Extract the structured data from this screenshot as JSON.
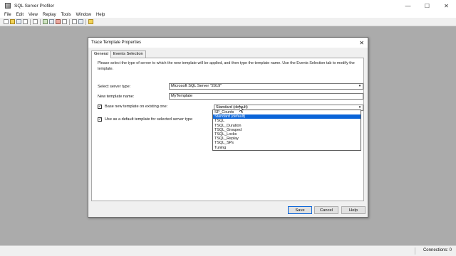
{
  "window": {
    "title": "SQL Server Profiler",
    "controls": {
      "minimize": "—",
      "maximize": "☐",
      "close": "✕"
    }
  },
  "menu": [
    "File",
    "Edit",
    "View",
    "Replay",
    "Tools",
    "Window",
    "Help"
  ],
  "toolbar_icons": [
    "new-trace-icon",
    "open-icon",
    "save-icon",
    "properties-icon",
    "find-icon",
    "run-icon",
    "pause-icon",
    "stop-icon",
    "clear-icon",
    "sql-icon",
    "monitor-icon",
    "help-icon"
  ],
  "status": {
    "connections": "Connections: 0"
  },
  "dialog": {
    "title": "Trace Template Properties",
    "close_glyph": "✕",
    "tabs": [
      {
        "label": "General",
        "active": true
      },
      {
        "label": "Events Selection",
        "active": false
      }
    ],
    "intro": "Please select the type of server to which the new template will be applied, and then type the template name.  Use the Events Selection tab to modify the template.",
    "server_type_label": "Select server type:",
    "server_type_value": "Microsoft SQL Server \"2019\"",
    "template_name_label": "New template name:",
    "template_name_value": "MyTemplate",
    "base_checkbox_label": "Base new template on existing one:",
    "base_checked": true,
    "default_checkbox_label": "Use as a default template for selected server type",
    "default_checked": true,
    "existing_template_value": "Standard (default)",
    "dropdown_options": [
      "SP_Counts",
      "Standard (default)",
      "TSQL",
      "TSQL_Duration",
      "TSQL_Grouped",
      "TSQL_Locks",
      "TSQL_Replay",
      "TSQL_SPs",
      "Tuning"
    ],
    "dropdown_selected_index": 1,
    "buttons": {
      "save": "Save",
      "cancel": "Cancel",
      "help": "Help"
    },
    "arrow_glyph": "▾",
    "check_glyph": "✓"
  }
}
